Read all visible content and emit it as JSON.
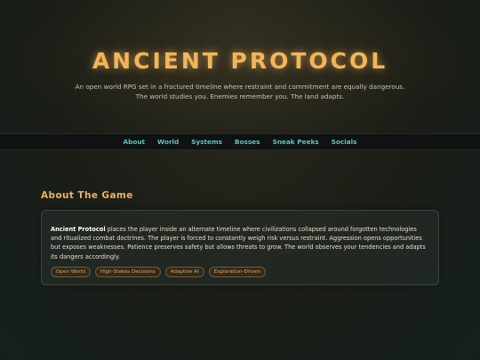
{
  "hero": {
    "title": "ANCIENT PROTOCOL",
    "tagline": "An open world RPG set in a fractured timeline where restraint and commitment are equally dangerous. The world studies you. Enemies remember you. The land adapts."
  },
  "nav": {
    "items": [
      {
        "label": "About"
      },
      {
        "label": "World"
      },
      {
        "label": "Systems"
      },
      {
        "label": "Bosses"
      },
      {
        "label": "Sneak Peeks"
      },
      {
        "label": "Socials"
      }
    ]
  },
  "about": {
    "heading": "About The Game",
    "game_name": "Ancient Protocol",
    "description": " places the player inside an alternate timeline where civilizations collapsed around forgotten technologies and ritualized combat doctrines. The player is forced to constantly weigh risk versus restraint. Aggression opens opportunities but exposes weaknesses. Patience preserves safety but allows threats to grow. The world observes your tendencies and adapts its dangers accordingly.",
    "tags": [
      "Open World",
      "High-Stakes Decisions",
      "Adaptive AI",
      "Exploration-Driven"
    ]
  },
  "colors": {
    "accent_gold": "#f2b55a",
    "nav_teal": "#58c6c2",
    "tag_orange": "#e3a257"
  }
}
